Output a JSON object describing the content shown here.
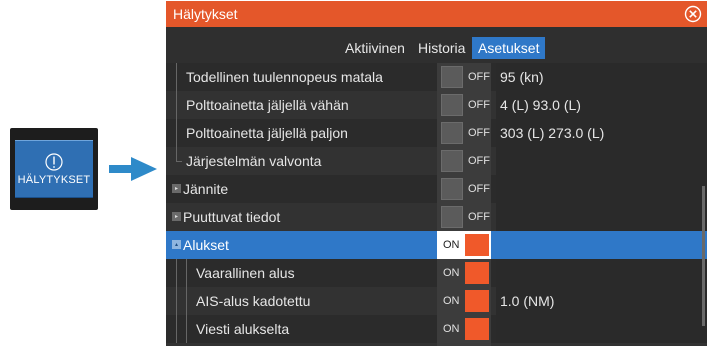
{
  "launcher": {
    "label": "HÄLYTYKSET",
    "icon": "alarm-info-icon"
  },
  "dialog": {
    "title": "Hälytykset",
    "close_icon": "close-icon",
    "tabs": [
      "Aktiivinen",
      "Historia",
      "Asetukset"
    ],
    "active_tab": "Asetukset"
  },
  "rows": [
    {
      "label": "Todellinen tuulennopeus matala",
      "state": "OFF",
      "value": "95 (kn)"
    },
    {
      "label": "Polttoainetta jäljellä vähän",
      "state": "OFF",
      "value": "4 (L)  93.0 (L)"
    },
    {
      "label": "Polttoainetta jäljellä paljon",
      "state": "OFF",
      "value": "303 (L)  273.0 (L)"
    },
    {
      "label": "Järjestelmän valvonta",
      "state": "OFF",
      "value": ""
    },
    {
      "label": "Jännite",
      "state": "OFF",
      "value": ""
    },
    {
      "label": "Puuttuvat tiedot",
      "state": "OFF",
      "value": ""
    },
    {
      "label": "Alukset",
      "state": "ON",
      "value": ""
    },
    {
      "label": "Vaarallinen alus",
      "state": "ON",
      "value": ""
    },
    {
      "label": "AIS-alus kadotettu",
      "state": "ON",
      "value": "1.0 (NM)"
    },
    {
      "label": "Viesti alukselta",
      "state": "ON",
      "value": ""
    }
  ],
  "colors": {
    "title_bar": "#e4572a",
    "selected_row": "#2f78c8",
    "toggle_on": "#f0592a",
    "launcher_blue": "#2f6fb3",
    "arrow": "#2e8ac9"
  }
}
